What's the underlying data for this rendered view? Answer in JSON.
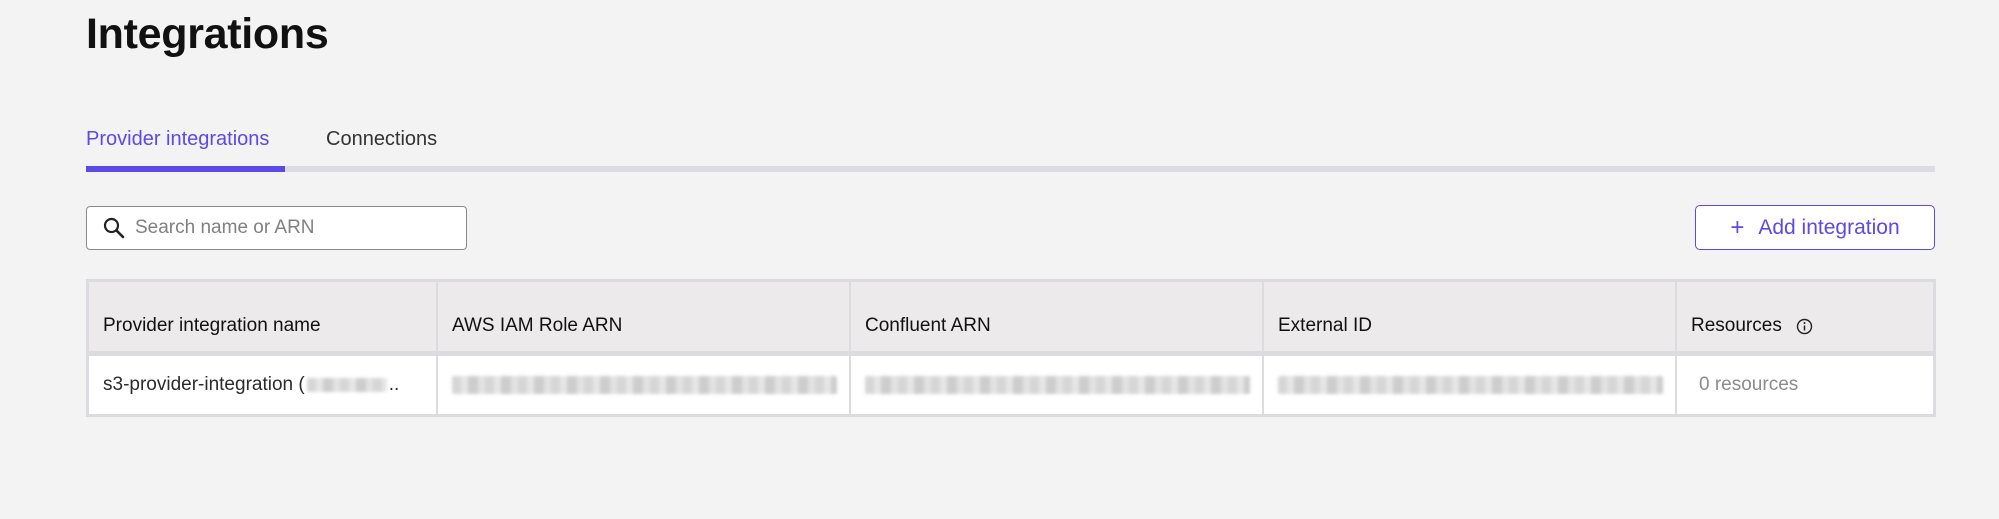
{
  "page": {
    "title": "Integrations"
  },
  "tabs": [
    {
      "label": "Provider integrations",
      "active": true
    },
    {
      "label": "Connections",
      "active": false
    }
  ],
  "search": {
    "placeholder": "Search name or ARN",
    "value": ""
  },
  "add_button": {
    "label": "Add integration",
    "icon": "plus-icon"
  },
  "table": {
    "columns": [
      "Provider integration name",
      "AWS IAM Role ARN",
      "Confluent ARN",
      "External ID",
      "Resources"
    ],
    "rows": [
      {
        "name_prefix": "s3-provider-integration (",
        "name_suffix": "..",
        "resources": "0 resources"
      }
    ]
  },
  "colors": {
    "accent": "#5b49e8",
    "background": "#f3f3f3"
  }
}
